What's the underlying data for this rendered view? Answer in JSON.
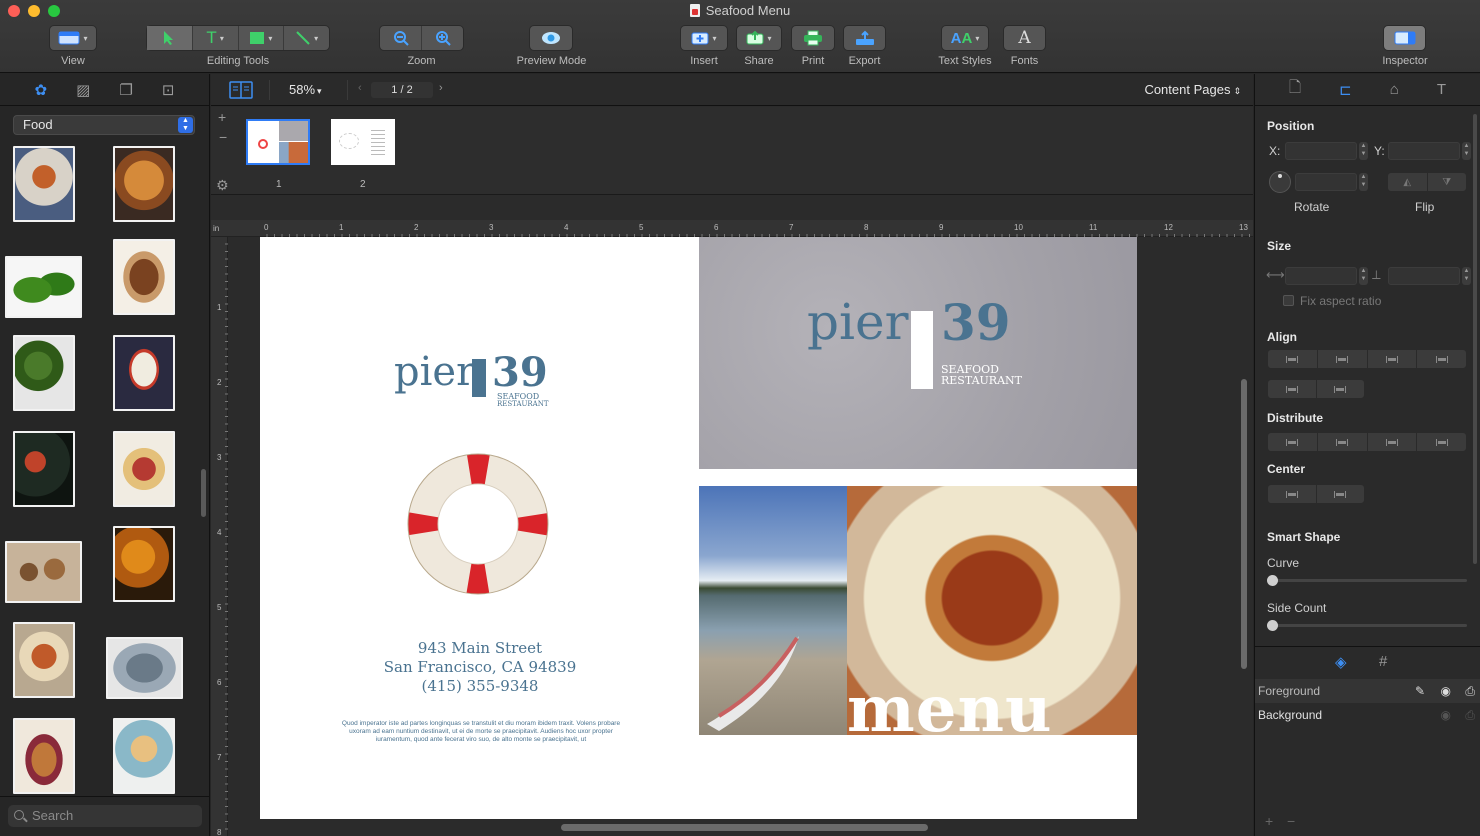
{
  "window": {
    "title": "Seafood Menu"
  },
  "toolbar": {
    "view": "View",
    "editing_tools": "Editing Tools",
    "zoom": "Zoom",
    "preview": "Preview Mode",
    "insert": "Insert",
    "share": "Share",
    "print": "Print",
    "export": "Export",
    "text_styles": "Text Styles",
    "fonts": "Fonts",
    "inspector": "Inspector"
  },
  "library": {
    "category": "Food",
    "search_placeholder": "Search"
  },
  "canvas_bar": {
    "zoom_value": "58%",
    "page_indicator": "1 / 2",
    "content_pages": "Content Pages"
  },
  "pages": [
    {
      "num": "1"
    },
    {
      "num": "2"
    }
  ],
  "ruler": {
    "unit": "in",
    "h_ticks": [
      "0",
      "1",
      "2",
      "3",
      "4",
      "5",
      "6",
      "7",
      "8",
      "9",
      "10",
      "11",
      "12",
      "13"
    ],
    "v_ticks": [
      "1",
      "2",
      "3",
      "4",
      "5",
      "6",
      "7",
      "8"
    ]
  },
  "document": {
    "logo_word": "pier",
    "logo_number": "39",
    "logo_sub1": "SEAFOOD",
    "logo_sub2": "RESTAURANT",
    "address1": "943 Main Street",
    "address2": "San Francisco, CA 94839",
    "phone": "(415) 355-9348",
    "lorem": "Quod imperator iste ad partes longinquas se transtulit et diu moram ibidem traxit. Volens probare uxoram ad eam nuntium destinavit, ut ei de morte se praecipitavit. Audiens hoc uxor propter iuramentum, quod ante fecerat viro suo, de alto monte se praecipitavit, ut",
    "menu_word": "menu"
  },
  "inspector": {
    "position": "Position",
    "x_label": "X:",
    "y_label": "Y:",
    "rotate": "Rotate",
    "flip": "Flip",
    "size": "Size",
    "fix_aspect": "Fix aspect ratio",
    "align": "Align",
    "distribute": "Distribute",
    "center": "Center",
    "smart_shape": "Smart Shape",
    "curve": "Curve",
    "side_count": "Side Count"
  },
  "layers": [
    {
      "name": "Foreground"
    },
    {
      "name": "Background"
    }
  ],
  "colors": {
    "accent": "#2f7cf6",
    "logo_blue": "#4a7390",
    "lifebuoy_red": "#d9242a"
  }
}
